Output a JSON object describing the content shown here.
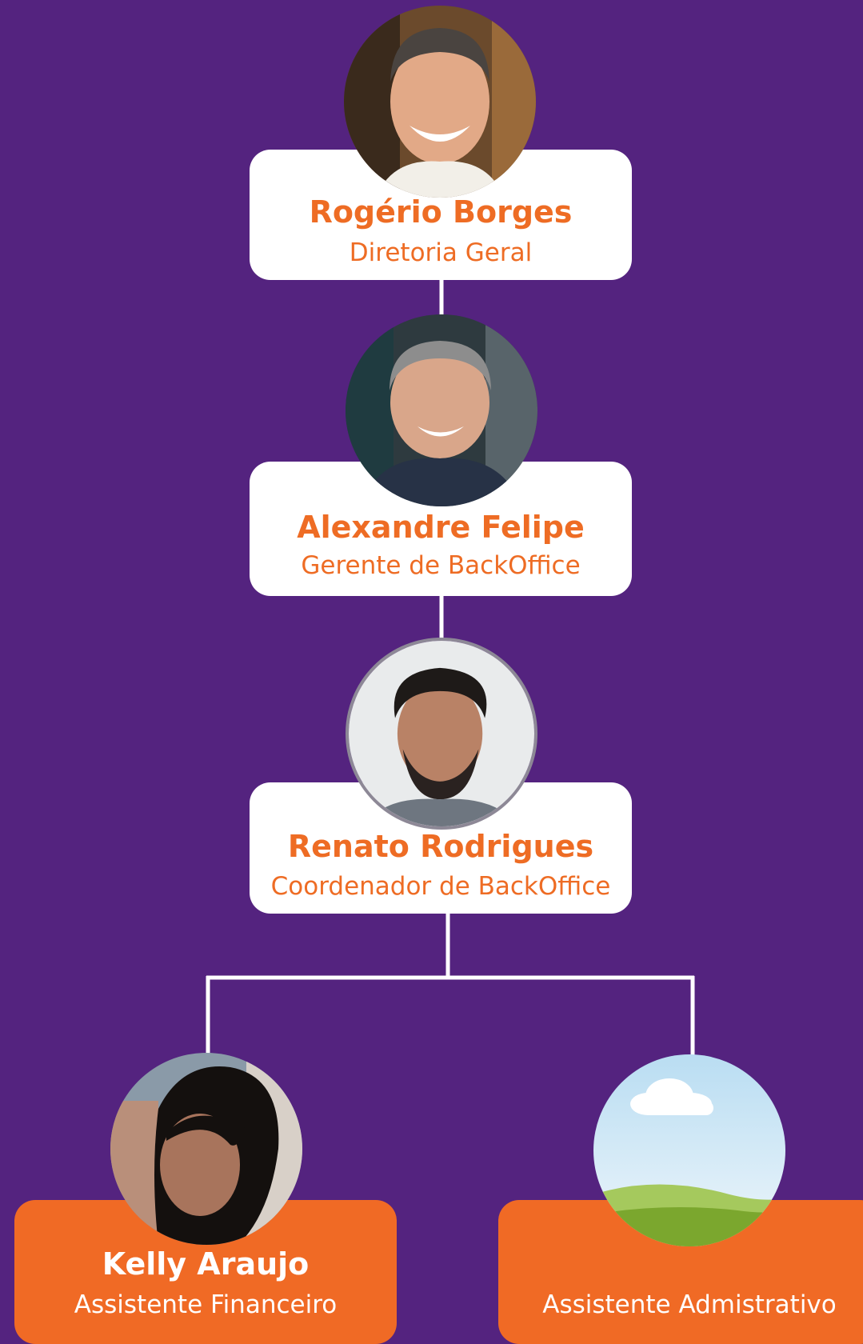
{
  "colors": {
    "background": "#54237f",
    "accent": "#ee6c24",
    "card_white": "#ffffff",
    "card_orange": "#f06a25",
    "connector": "#ffffff"
  },
  "nodes": [
    {
      "name": "Rogério Borges",
      "role": "Diretoria Geral",
      "avatar_icon": "person-photo-icon"
    },
    {
      "name": "Alexandre Felipe",
      "role": "Gerente de BackOffice",
      "avatar_icon": "person-photo-icon"
    },
    {
      "name": "Renato Rodrigues",
      "role": "Coordenador de BackOffice",
      "avatar_icon": "person-photo-icon"
    },
    {
      "name": "Kelly Araujo",
      "role": "Assistente Financeiro",
      "avatar_icon": "person-photo-icon"
    },
    {
      "name": "",
      "role": "Assistente Admistrativo",
      "avatar_icon": "landscape-placeholder-icon"
    }
  ]
}
